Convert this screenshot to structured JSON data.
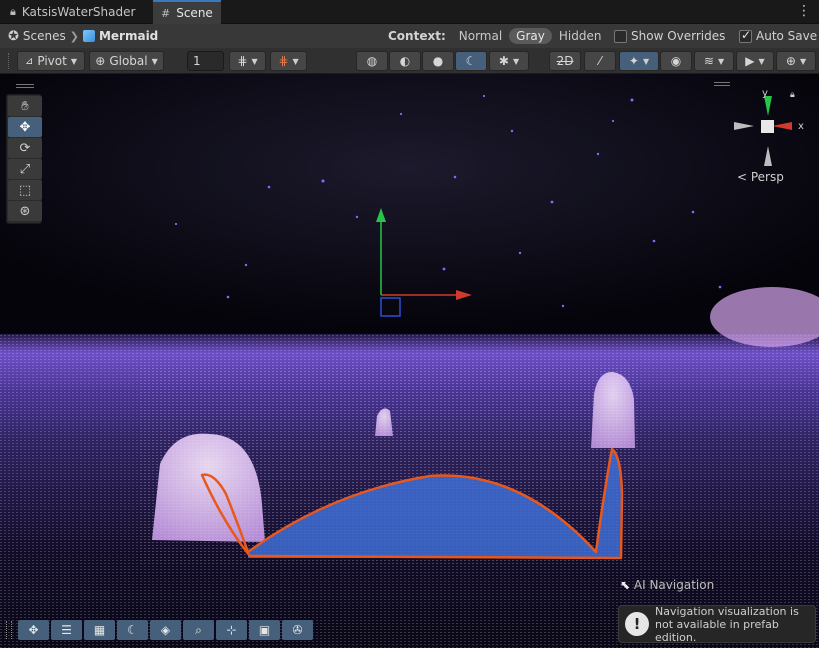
{
  "tabs": [
    {
      "label": "KatsisWaterShader",
      "icon": "lock-icon"
    },
    {
      "label": "Scene",
      "icon": "grid-icon"
    }
  ],
  "breadcrumb": {
    "root": "Scenes",
    "current": "Mermaid"
  },
  "context": {
    "label": "Context:",
    "options": [
      "Normal",
      "Gray",
      "Hidden"
    ],
    "selected": "Gray",
    "show_overrides_label": "Show Overrides",
    "show_overrides_checked": false,
    "auto_save_label": "Auto Save",
    "auto_save_checked": true
  },
  "toolbar": {
    "pivot_label": "Pivot",
    "global_label": "Global",
    "grid_snap_value": "1"
  },
  "tool_palette": [
    "hand-tool",
    "move-tool",
    "rotate-tool",
    "scale-tool",
    "rect-tool",
    "transform-tool"
  ],
  "gizmo": {
    "y_label": "y",
    "x_label": "x",
    "projection_label": "< Persp"
  },
  "overlay_label": "AI Navigation",
  "notice_text": "Navigation visualization is not available in prefab edition.",
  "colors": {
    "accent": "#3a79bb",
    "button_active": "#46607c",
    "nav_outline": "#e8581c",
    "nav_fill": "#3f6fd6",
    "ghost": "#e8c8f8",
    "water": "#7a56d8"
  }
}
